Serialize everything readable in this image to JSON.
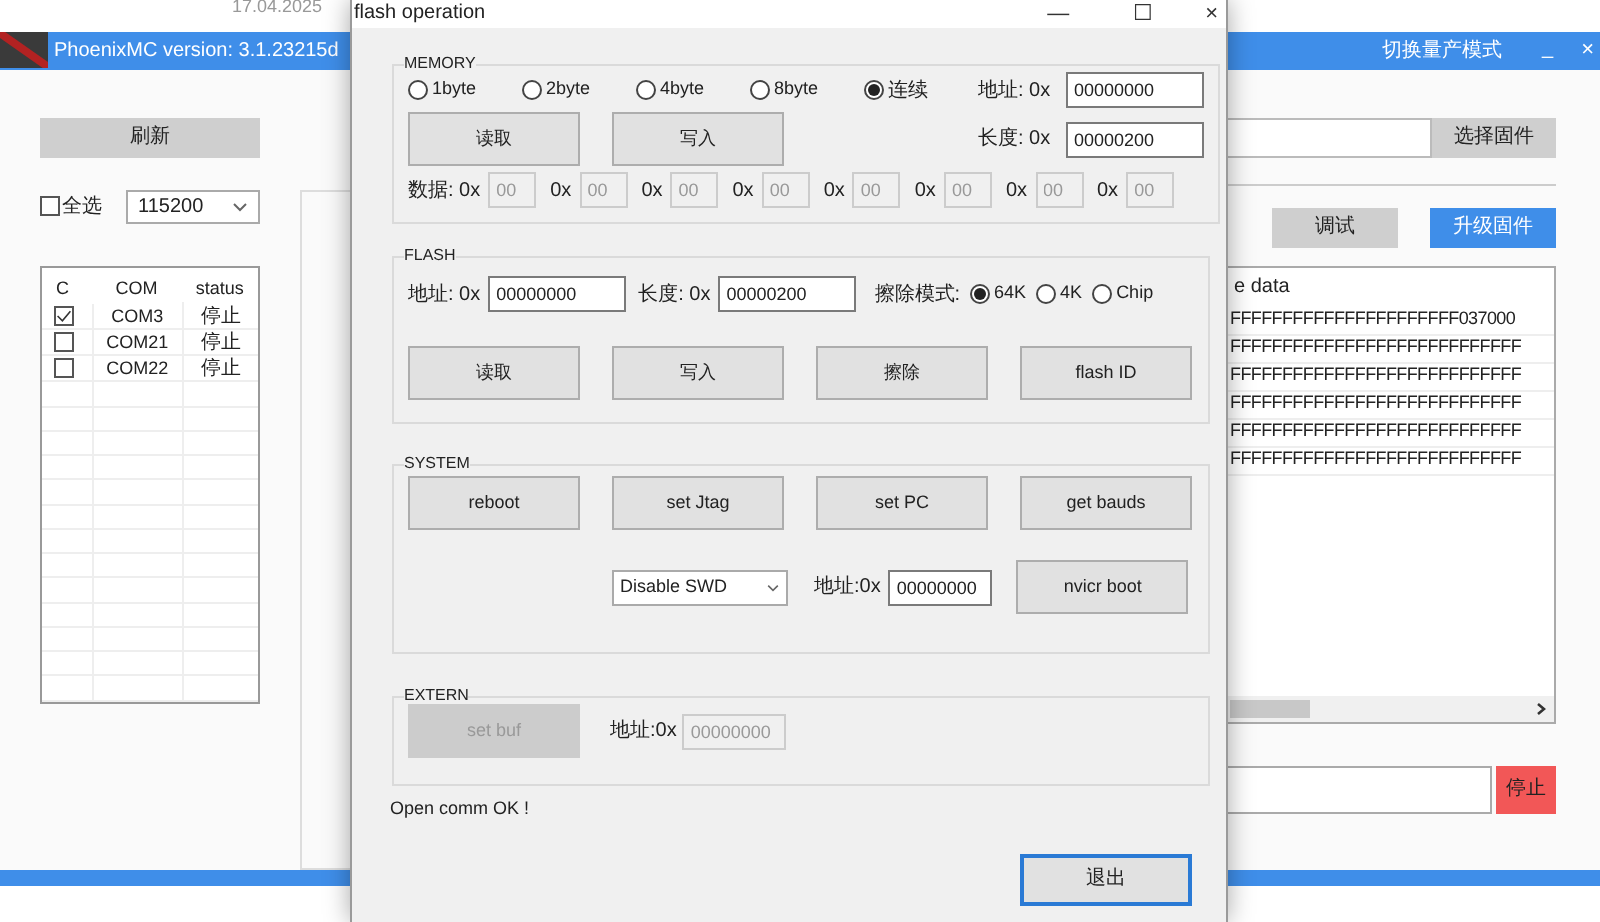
{
  "desktop_text": "17.04.2025",
  "main_window": {
    "title": "PhoenixMC version: 3.1.23215d",
    "mode_switch": "切换量产模式",
    "minimize": "_",
    "close": "×",
    "refresh_button": "刷新",
    "select_all": {
      "label": "全选",
      "checked": false
    },
    "baud_rate": "115200",
    "port_table": {
      "columns": [
        "C",
        "COM",
        "status"
      ],
      "rows": [
        {
          "checked": true,
          "com": "COM3",
          "status": "停止"
        },
        {
          "checked": false,
          "com": "COM21",
          "status": "停止"
        },
        {
          "checked": false,
          "com": "COM22",
          "status": "停止"
        }
      ]
    },
    "firmware_button": "选择固件",
    "mode_tabs": [
      {
        "label": "调试",
        "selected": false
      },
      {
        "label": "升级固件",
        "selected": true
      }
    ],
    "data_log": {
      "header": "e data",
      "lines": [
        "FFFFFFFFFFFFFFFFFFFFFF037000",
        "FFFFFFFFFFFFFFFFFFFFFFFFFFFF",
        "FFFFFFFFFFFFFFFFFFFFFFFFFFFF",
        "FFFFFFFFFFFFFFFFFFFFFFFFFFFF",
        "FFFFFFFFFFFFFFFFFFFFFFFFFFFF",
        "FFFFFFFFFFFFFFFFFFFFFFFFFFFF"
      ]
    },
    "stop_button": "停止"
  },
  "dialog": {
    "title": "flash operation",
    "window_controls": [
      "—",
      "☐",
      "×"
    ],
    "memory": {
      "legend": "MEMORY",
      "widths": [
        {
          "label": "1byte",
          "selected": false
        },
        {
          "label": "2byte",
          "selected": false
        },
        {
          "label": "4byte",
          "selected": false
        },
        {
          "label": "8byte",
          "selected": false
        },
        {
          "label": "连续",
          "selected": true
        }
      ],
      "address": {
        "label": "地址: 0x",
        "value": "00000000"
      },
      "length": {
        "label": "长度: 0x",
        "value": "00000200"
      },
      "buttons": [
        "读取",
        "写入"
      ],
      "data_fields": [
        {
          "label": "数据: 0x",
          "value": "00",
          "disabled": true
        },
        {
          "label": "0x",
          "value": "00",
          "disabled": true
        },
        {
          "label": "0x",
          "value": "00",
          "disabled": true
        },
        {
          "label": "0x",
          "value": "00",
          "disabled": true
        },
        {
          "label": "0x",
          "value": "00",
          "disabled": true
        },
        {
          "label": "0x",
          "value": "00",
          "disabled": true
        },
        {
          "label": "0x",
          "value": "00",
          "disabled": true
        },
        {
          "label": "0x",
          "value": "00",
          "disabled": true
        }
      ]
    },
    "flash": {
      "legend": "FLASH",
      "address": {
        "label": "地址: 0x",
        "value": "00000000"
      },
      "length": {
        "label": "长度: 0x",
        "value": "00000200"
      },
      "erase_label": "擦除模式:",
      "erase_modes": [
        {
          "label": "64K",
          "selected": true
        },
        {
          "label": "4K",
          "selected": false
        },
        {
          "label": "Chip",
          "selected": false
        }
      ],
      "buttons": [
        "读取",
        "写入",
        "擦除",
        "flash ID"
      ]
    },
    "system": {
      "legend": "SYSTEM",
      "buttons": [
        "reboot",
        "set Jtag",
        "set PC",
        "get bauds"
      ],
      "swd_select": "Disable SWD",
      "address": {
        "label": "地址:0x",
        "value": "00000000"
      },
      "boot_button": "nvicr boot"
    },
    "extern": {
      "legend": "EXTERN",
      "button": {
        "label": "set buf",
        "disabled": true
      },
      "address": {
        "label": "地址:0x",
        "value": "00000000",
        "disabled": true
      }
    },
    "status_message": "Open comm OK !",
    "exit_button": {
      "label": "退出",
      "focused": true
    }
  }
}
